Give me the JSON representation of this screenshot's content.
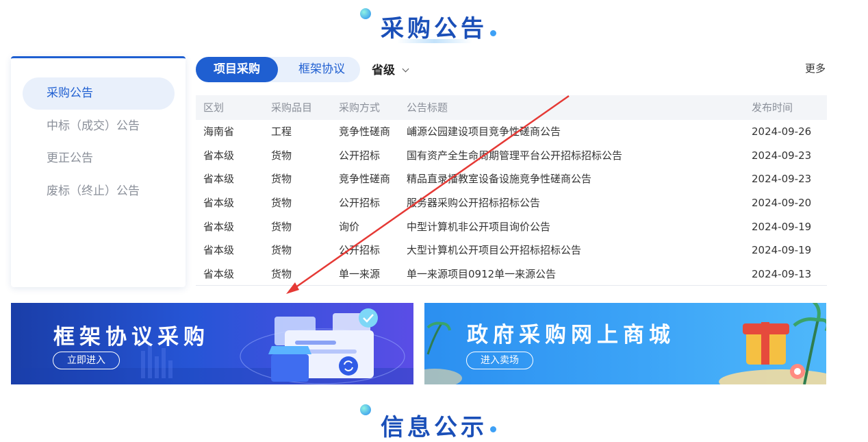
{
  "section_procurement": {
    "title": "采购公告"
  },
  "sidebar": {
    "items": [
      {
        "label": "采购公告",
        "active": true
      },
      {
        "label": "中标（成交）公告",
        "active": false
      },
      {
        "label": "更正公告",
        "active": false
      },
      {
        "label": "废标（终止）公告",
        "active": false
      }
    ]
  },
  "tabs": [
    {
      "label": "项目采购",
      "active": true
    },
    {
      "label": "框架协议",
      "active": false
    }
  ],
  "region_select": {
    "value": "省级",
    "icon": "chevron-down-icon"
  },
  "more_link": "更多",
  "table": {
    "headers": [
      "区划",
      "采购品目",
      "采购方式",
      "公告标题",
      "发布时间"
    ],
    "rows": [
      [
        "海南省",
        "工程",
        "竞争性磋商",
        "峬源公园建设项目竞争性磋商公告",
        "2024-09-26"
      ],
      [
        "省本级",
        "货物",
        "公开招标",
        "国有资产全生命周期管理平台公开招标招标公告",
        "2024-09-23"
      ],
      [
        "省本级",
        "货物",
        "竞争性磋商",
        "精品直录播教室设备设施竞争性磋商公告",
        "2024-09-23"
      ],
      [
        "省本级",
        "货物",
        "公开招标",
        "服务器采购公开招标招标公告",
        "2024-09-20"
      ],
      [
        "省本级",
        "货物",
        "询价",
        "中型计算机非公开项目询价公告",
        "2024-09-19"
      ],
      [
        "省本级",
        "货物",
        "公开招标",
        "大型计算机公开项目公开招标招标公告",
        "2024-09-19"
      ],
      [
        "省本级",
        "货物",
        "单一来源",
        "单一来源项目0912单一来源公告",
        "2024-09-13"
      ]
    ]
  },
  "annotation_arrow": {
    "color": "#e53935"
  },
  "banners": [
    {
      "title": "框架协议采购",
      "button": "立即进入"
    },
    {
      "title": "政府采购网上商城",
      "button": "进入卖场"
    }
  ],
  "section_info": {
    "title": "信息公示"
  },
  "colors": {
    "primary": "#1f5fd1",
    "title": "#1a4fb8",
    "arrow": "#e53935"
  }
}
